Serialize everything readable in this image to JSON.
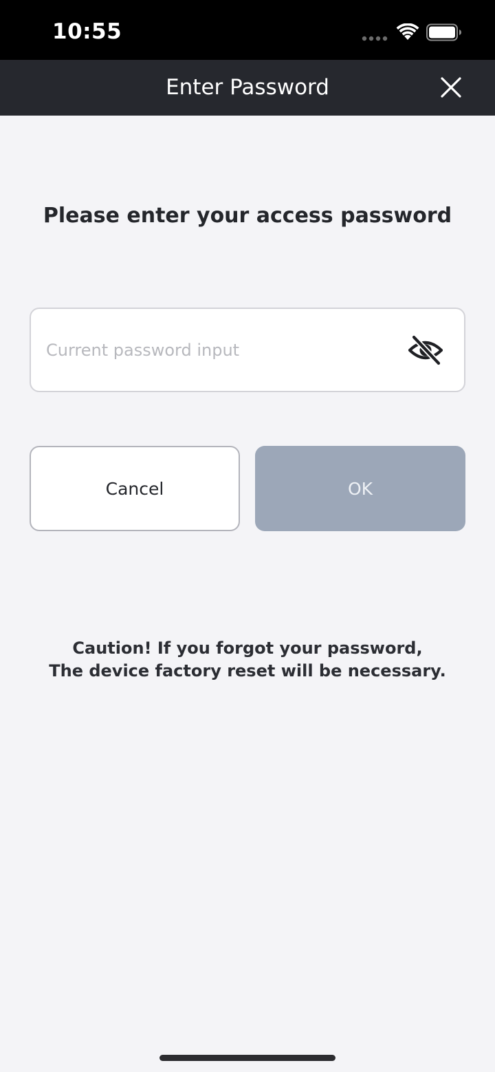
{
  "status_bar": {
    "time": "10:55"
  },
  "header": {
    "title": "Enter Password"
  },
  "main": {
    "prompt": "Please enter your access password",
    "password_input": {
      "value": "",
      "placeholder": "Current password input"
    },
    "buttons": {
      "cancel_label": "Cancel",
      "ok_label": "OK"
    },
    "caution": {
      "line1": "Caution! If you forgot your password,",
      "line2": "The device factory reset will be necessary."
    }
  },
  "icons": {
    "close": "close-icon",
    "visibility": "eye-off-icon",
    "wifi": "wifi-icon",
    "battery": "battery-icon"
  },
  "colors": {
    "header_bg": "#26282e",
    "ok_disabled_bg": "#9ca7b8",
    "page_bg": "#f4f4f7"
  }
}
